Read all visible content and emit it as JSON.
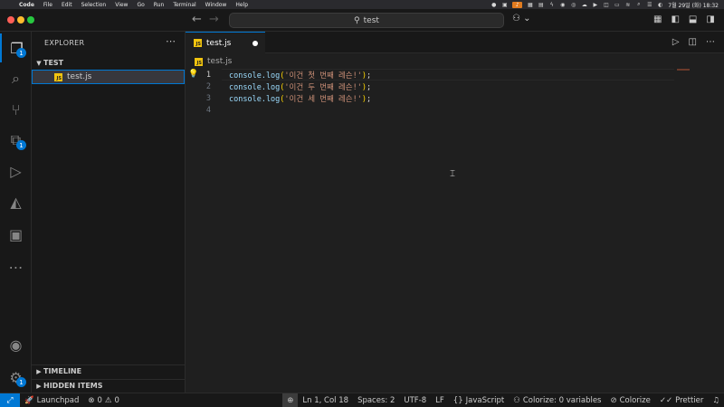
{
  "menubar": {
    "app_name": "Code",
    "items": [
      "File",
      "Edit",
      "Selection",
      "View",
      "Go",
      "Run",
      "Terminal",
      "Window",
      "Help"
    ],
    "clock": "7월 29일 (화) 18:32"
  },
  "titlebar": {
    "search_text": "test"
  },
  "activitybar": {
    "explorer_badge": "1",
    "extensions_badge": "1",
    "settings_badge": "1"
  },
  "sidebar": {
    "title": "EXPLORER",
    "folder": "TEST",
    "file": "test.js",
    "timeline": "TIMELINE",
    "hidden_items": "HIDDEN ITEMS"
  },
  "editor": {
    "tab_label": "test.js",
    "breadcrumb": "test.js",
    "file_icon_text": "JS",
    "lines": [
      {
        "num": "1",
        "fn": "console.log",
        "str": "'이건 첫 번째 레슨!'"
      },
      {
        "num": "2",
        "fn": "console.log",
        "str": "'이건 두 번째 레슨!'"
      },
      {
        "num": "3",
        "fn": "console.log",
        "str": "'이건 세 번째 레슨!'"
      },
      {
        "num": "4"
      }
    ]
  },
  "statusbar": {
    "launchpad": "Launchpad",
    "errors": "0",
    "warnings": "0",
    "position": "Ln 1, Col 18",
    "spaces": "Spaces: 2",
    "encoding": "UTF-8",
    "eol": "LF",
    "language": "JavaScript",
    "colorize_vars": "Colorize: 0 variables",
    "colorize": "Colorize",
    "prettier": "Prettier"
  },
  "colors": {
    "accent": "#0078d4",
    "string": "#ce9178",
    "function": "#9cdcfe",
    "bracket": "#ffd700"
  }
}
